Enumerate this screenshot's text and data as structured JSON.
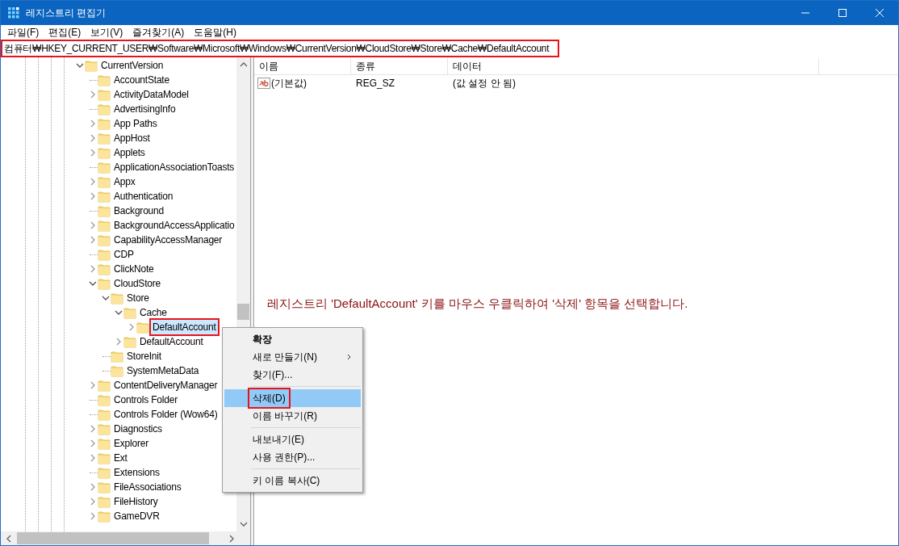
{
  "window": {
    "title": "레지스트리 편집기"
  },
  "menu": [
    "파일(F)",
    "편집(E)",
    "보기(V)",
    "즐겨찾기(A)",
    "도움말(H)"
  ],
  "address_bar": {
    "value": "컴퓨터₩HKEY_CURRENT_USER₩Software₩Microsoft₩Windows₩CurrentVersion₩CloudStore₩Store₩Cache₩DefaultAccount",
    "annotated": true
  },
  "tree": [
    {
      "label": "CurrentVersion",
      "expanded": true,
      "selected": false,
      "children": [
        {
          "label": "AccountState",
          "selected": false
        },
        {
          "label": "ActivityDataModel",
          "expanded": false,
          "selected": false
        },
        {
          "label": "AdvertisingInfo",
          "selected": false
        },
        {
          "label": "App Paths",
          "expanded": false,
          "selected": false
        },
        {
          "label": "AppHost",
          "expanded": false,
          "selected": false
        },
        {
          "label": "Applets",
          "expanded": false,
          "selected": false
        },
        {
          "label": "ApplicationAssociationToasts",
          "selected": false
        },
        {
          "label": "Appx",
          "expanded": false,
          "selected": false
        },
        {
          "label": "Authentication",
          "expanded": false,
          "selected": false
        },
        {
          "label": "Background",
          "selected": false
        },
        {
          "label": "BackgroundAccessApplicatio",
          "expanded": false,
          "selected": false
        },
        {
          "label": "CapabilityAccessManager",
          "expanded": false,
          "selected": false
        },
        {
          "label": "CDP",
          "selected": false
        },
        {
          "label": "ClickNote",
          "expanded": false,
          "selected": false
        },
        {
          "label": "CloudStore",
          "expanded": true,
          "selected": false,
          "children": [
            {
              "label": "Store",
              "expanded": true,
              "selected": false,
              "children": [
                {
                  "label": "Cache",
                  "expanded": true,
                  "selected": false,
                  "children": [
                    {
                      "label": "DefaultAccount",
                      "expanded": false,
                      "selected": true,
                      "annotated": true
                    }
                  ]
                },
                {
                  "label": "DefaultAccount",
                  "expanded": false,
                  "selected": false
                }
              ]
            },
            {
              "label": "StoreInit",
              "selected": false
            },
            {
              "label": "SystemMetaData",
              "selected": false
            }
          ]
        },
        {
          "label": "ContentDeliveryManager",
          "expanded": false,
          "selected": false
        },
        {
          "label": "Controls Folder",
          "selected": false
        },
        {
          "label": "Controls Folder (Wow64)",
          "selected": false
        },
        {
          "label": "Diagnostics",
          "expanded": false,
          "selected": false
        },
        {
          "label": "Explorer",
          "expanded": false,
          "selected": false
        },
        {
          "label": "Ext",
          "expanded": false,
          "selected": false
        },
        {
          "label": "Extensions",
          "selected": false
        },
        {
          "label": "FileAssociations",
          "expanded": false,
          "selected": false
        },
        {
          "label": "FileHistory",
          "expanded": false,
          "selected": false
        },
        {
          "label": "GameDVR",
          "expanded": false,
          "selected": false
        }
      ]
    }
  ],
  "values_table": {
    "columns": [
      "이름",
      "종류",
      "데이터"
    ],
    "rows": [
      {
        "name": "(기본값)",
        "type": "REG_SZ",
        "data": "(값 설정 안 됨)"
      }
    ]
  },
  "instruction": "레지스트리 'DefaultAccount' 키를 마우스 우클릭하여 '삭제' 항목을 선택합니다.",
  "context_menu": [
    {
      "kind": "item",
      "label": "확장",
      "bold": true,
      "selected": false
    },
    {
      "kind": "item",
      "label": "새로 만들기(N)",
      "submenu": true,
      "selected": false
    },
    {
      "kind": "item",
      "label": "찾기(F)...",
      "selected": false
    },
    {
      "kind": "separator"
    },
    {
      "kind": "item",
      "label": "삭제(D)",
      "selected": true,
      "annotated": true
    },
    {
      "kind": "item",
      "label": "이름 바꾸기(R)",
      "selected": false
    },
    {
      "kind": "separator"
    },
    {
      "kind": "item",
      "label": "내보내기(E)",
      "selected": false
    },
    {
      "kind": "item",
      "label": "사용 권한(P)...",
      "selected": false
    },
    {
      "kind": "separator"
    },
    {
      "kind": "item",
      "label": "키 이름 복사(C)",
      "selected": false
    }
  ]
}
